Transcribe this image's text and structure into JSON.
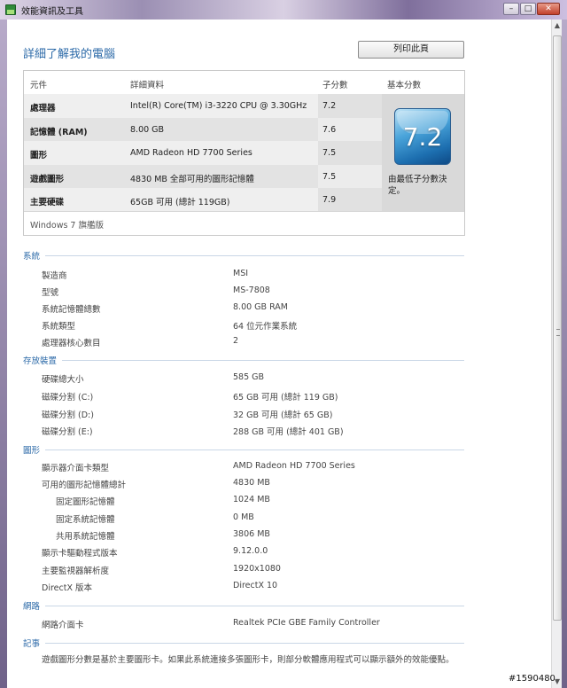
{
  "window": {
    "title": "效能資訊及工具",
    "buttons": {
      "minimize": "–",
      "maximize": "□",
      "close": "✕"
    }
  },
  "page": {
    "title": "詳細了解我的電腦",
    "print_button": "列印此頁"
  },
  "score_table": {
    "headers": {
      "component": "元件",
      "details": "詳細資料",
      "subscore": "子分數",
      "base": "基本分數"
    },
    "rows": [
      {
        "component": "處理器",
        "details": "Intel(R) Core(TM) i3-3220 CPU @ 3.30GHz",
        "subscore": "7.2"
      },
      {
        "component": "記憶體 (RAM)",
        "details": "8.00 GB",
        "subscore": "7.6"
      },
      {
        "component": "圖形",
        "details": "AMD Radeon HD 7700 Series",
        "subscore": "7.5"
      },
      {
        "component": "遊戲圖形",
        "details": "4830 MB 全部可用的圖形記憶體",
        "subscore": "7.5"
      },
      {
        "component": "主要硬碟",
        "details": "65GB 可用 (總計 119GB)",
        "subscore": "7.9"
      }
    ],
    "base_score": "7.2",
    "base_caption": "由最低子分數決定。",
    "edition": "Windows 7 旗艦版"
  },
  "sections": {
    "system": {
      "title": "系統",
      "items": [
        {
          "label": "製造商",
          "value": "MSI"
        },
        {
          "label": "型號",
          "value": "MS-7808"
        },
        {
          "label": "系統記憶體總數",
          "value": "8.00 GB RAM"
        },
        {
          "label": "系統類型",
          "value": "64 位元作業系統"
        },
        {
          "label": "處理器核心數目",
          "value": "2"
        }
      ]
    },
    "storage": {
      "title": "存放裝置",
      "items": [
        {
          "label": "硬碟總大小",
          "value": "585 GB"
        },
        {
          "label": "磁碟分割 (C:)",
          "value": "65 GB 可用 (總計 119 GB)"
        },
        {
          "label": "磁碟分割 (D:)",
          "value": "32 GB 可用 (總計 65 GB)"
        },
        {
          "label": "磁碟分割 (E:)",
          "value": "288 GB 可用 (總計 401 GB)"
        }
      ]
    },
    "graphics": {
      "title": "圖形",
      "items": [
        {
          "label": "顯示器介面卡類型",
          "value": "AMD Radeon HD 7700 Series"
        },
        {
          "label": "可用的圖形記憶體總計",
          "value": "4830 MB"
        },
        {
          "label": "固定圖形記憶體",
          "value": "1024 MB"
        },
        {
          "label": "固定系統記憶體",
          "value": "0 MB"
        },
        {
          "label": "共用系統記憶體",
          "value": "3806 MB"
        },
        {
          "label": "顯示卡驅動程式版本",
          "value": "9.12.0.0"
        },
        {
          "label": "主要監視器解析度",
          "value": "1920x1080"
        },
        {
          "label": "DirectX 版本",
          "value": "DirectX 10"
        }
      ]
    },
    "network": {
      "title": "網路",
      "items": [
        {
          "label": "網路介面卡",
          "value": "Realtek PCIe GBE Family Controller"
        }
      ]
    },
    "notes": {
      "title": "記事",
      "text": "遊戲圖形分數是基於主要圖形卡。如果此系統連接多張圖形卡，則部分軟體應用程式可以顯示額外的效能優點。"
    }
  },
  "watermark": "#1590480"
}
